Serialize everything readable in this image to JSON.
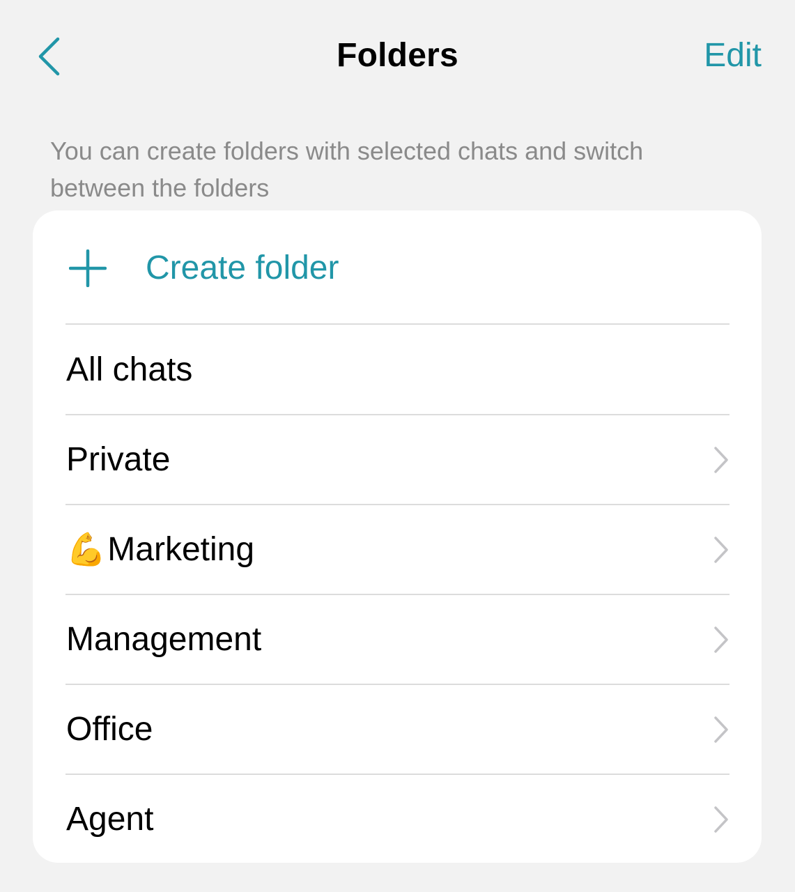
{
  "nav": {
    "title": "Folders",
    "edit_label": "Edit",
    "back_icon": "chevron-left-icon"
  },
  "description": "You can create folders with selected chats and switch between the folders",
  "create_folder": {
    "label": "Create folder",
    "icon": "plus-icon"
  },
  "folders": [
    {
      "label": "All chats",
      "emoji": "",
      "has_chevron": false
    },
    {
      "label": "Private",
      "emoji": "",
      "has_chevron": true
    },
    {
      "label": "Marketing",
      "emoji": "💪",
      "has_chevron": true
    },
    {
      "label": "Management",
      "emoji": "",
      "has_chevron": true
    },
    {
      "label": "Office",
      "emoji": "",
      "has_chevron": true
    },
    {
      "label": "Agent",
      "emoji": "",
      "has_chevron": true
    }
  ],
  "colors": {
    "accent": "#2196a8",
    "background": "#f2f2f2",
    "card": "#ffffff",
    "secondary_text": "#8a8a8a",
    "divider": "#dcdcdc",
    "chevron": "#c4c4c7"
  }
}
